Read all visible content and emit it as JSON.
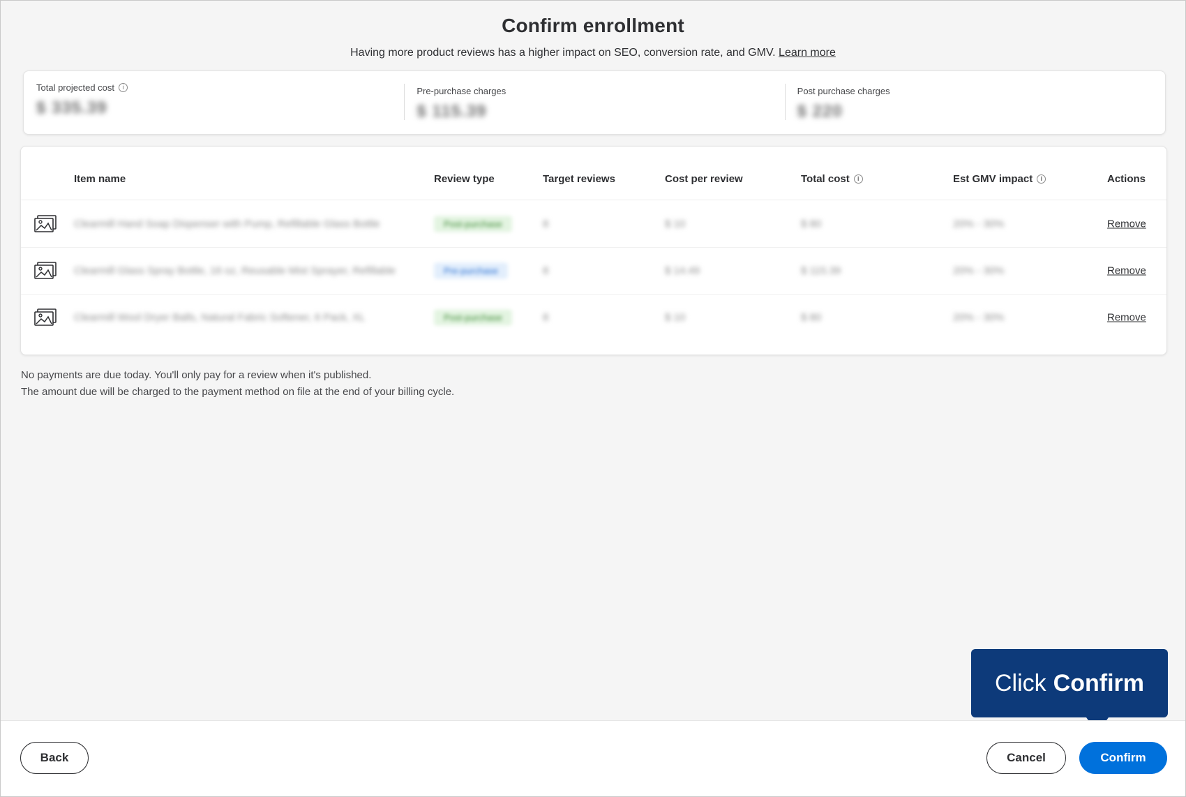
{
  "header": {
    "title": "Confirm enrollment",
    "subtitle": "Having more product reviews has a higher impact on SEO, conversion rate, and GMV.",
    "learn_more": "Learn more"
  },
  "summary": [
    {
      "label": "Total projected cost",
      "value": "$ 335.39",
      "has_info": true
    },
    {
      "label": "Pre-purchase charges",
      "value": "$ 115.39",
      "has_info": false
    },
    {
      "label": "Post purchase charges",
      "value": "$ 220",
      "has_info": false
    }
  ],
  "table": {
    "columns": {
      "item_name": "Item name",
      "review_type": "Review type",
      "target_reviews": "Target reviews",
      "cost_per_review": "Cost per review",
      "total_cost": "Total cost",
      "est_gmv_impact": "Est GMV impact",
      "actions": "Actions"
    },
    "rows": [
      {
        "item": "Clearmill Hand Soap Dispenser with Pump, Refillable Glass Bottle",
        "review_type": "Post-purchase",
        "type_color": "#e3f4e1",
        "type_text_color": "#3e8a36",
        "target": "8",
        "cost": "$ 10",
        "total": "$ 80",
        "gmv": "20% - 30%",
        "action": "Remove"
      },
      {
        "item": "Clearmill Glass Spray Bottle, 16 oz, Reusable Mist Sprayer, Refillable",
        "review_type": "Pre-purchase",
        "type_color": "#e2eefc",
        "type_text_color": "#2a6fd1",
        "target": "8",
        "cost": "$ 14.49",
        "total": "$ 115.39",
        "gmv": "20% - 30%",
        "action": "Remove"
      },
      {
        "item": "Clearmill Wool Dryer Balls, Natural Fabric Softener, 6 Pack, XL",
        "review_type": "Post-purchase",
        "type_color": "#e3f4e1",
        "type_text_color": "#3e8a36",
        "target": "8",
        "cost": "$ 10",
        "total": "$ 80",
        "gmv": "20% - 30%",
        "action": "Remove"
      }
    ]
  },
  "note": {
    "line1": "No payments are due today. You'll only pay for a review when it's published.",
    "line2": "The amount due will be charged to the payment method on file at the end of your billing cycle."
  },
  "footer": {
    "back": "Back",
    "cancel": "Cancel",
    "confirm": "Confirm"
  },
  "callout": {
    "prefix": "Click",
    "emphasis": "Confirm"
  },
  "colors": {
    "primary": "#0071dc",
    "callout": "#0d3a7a"
  }
}
